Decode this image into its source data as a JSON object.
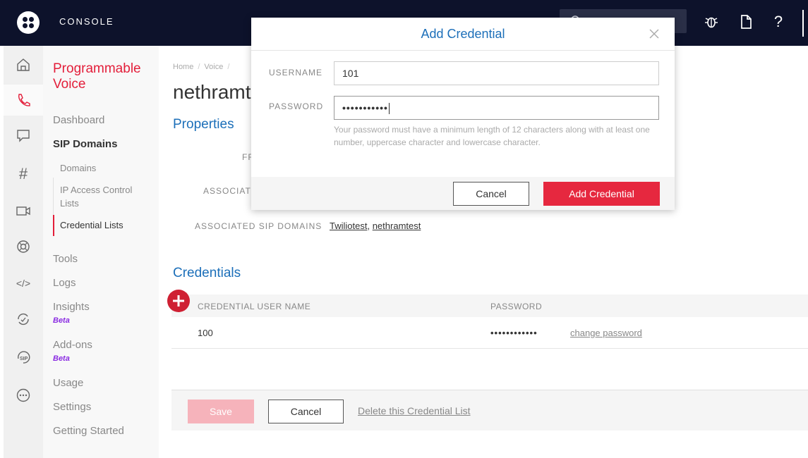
{
  "topbar": {
    "title": "CONSOLE"
  },
  "sidenav": {
    "product_title": "Programmable Voice",
    "items": [
      {
        "label": "Dashboard"
      },
      {
        "label": "SIP Domains"
      },
      {
        "label": "Tools"
      },
      {
        "label": "Logs"
      },
      {
        "label": "Insights",
        "badge": "Beta"
      },
      {
        "label": "Add-ons",
        "badge": "Beta"
      },
      {
        "label": "Usage"
      },
      {
        "label": "Settings"
      },
      {
        "label": "Getting Started"
      }
    ],
    "sub_items": [
      {
        "label": "Domains"
      },
      {
        "label": "IP Access Control Lists"
      },
      {
        "label": "Credential Lists"
      }
    ]
  },
  "main": {
    "breadcrumb": [
      "Home",
      "Voice"
    ],
    "page_heading": "nethramtest",
    "properties_title": "Properties",
    "props": [
      {
        "label": "FR"
      },
      {
        "label": "ASSOCIATE"
      },
      {
        "label": "ASSOCIATED SIP DOMAINS",
        "links": [
          "Twiliotest",
          "nethramtest"
        ]
      }
    ],
    "credentials_title": "Credentials",
    "table": {
      "columns": [
        "CREDENTIAL USER NAME",
        "PASSWORD"
      ],
      "rows": [
        {
          "username": "100",
          "password": "••••••••••••",
          "action": "change password"
        }
      ]
    },
    "footer": {
      "save": "Save",
      "cancel": "Cancel",
      "delete": "Delete this Credential List"
    }
  },
  "modal": {
    "title": "Add Credential",
    "username_label": "USERNAME",
    "username_value": "101",
    "password_label": "PASSWORD",
    "password_value": "•••••••••••",
    "hint": "Your password must have a minimum length of 12 characters along with at least one number, uppercase character and lowercase character.",
    "cancel": "Cancel",
    "submit": "Add Credential"
  },
  "colors": {
    "accent_red": "#e6283f",
    "link_blue": "#1c6fb9",
    "topbar": "#0d122b"
  },
  "icons": [
    "twilio-logo-icon",
    "search-icon",
    "bug-icon",
    "docs-icon",
    "help-icon",
    "home-icon",
    "phone-icon",
    "chat-icon",
    "hash-icon",
    "video-icon",
    "support-icon",
    "code-icon",
    "sync-icon",
    "sip-icon",
    "more-icon",
    "close-icon",
    "plus-icon"
  ]
}
